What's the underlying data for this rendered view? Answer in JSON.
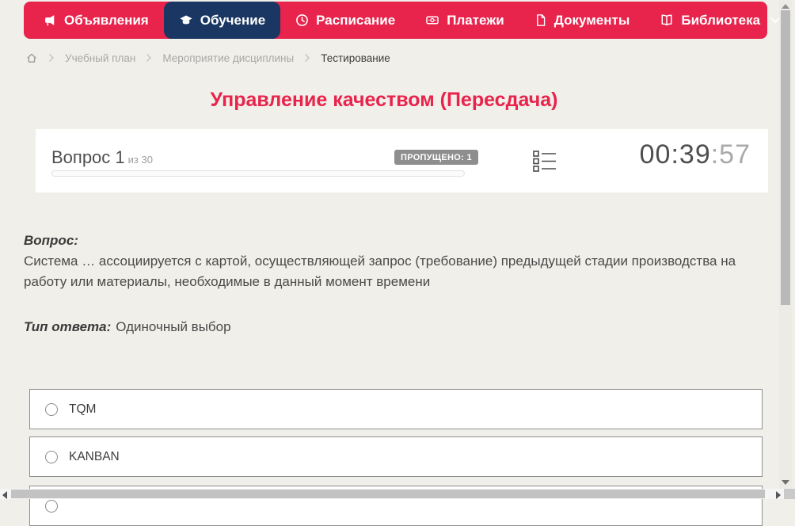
{
  "nav": {
    "items": [
      {
        "label": "Объявления",
        "icon": "megaphone-icon",
        "active": false
      },
      {
        "label": "Обучение",
        "icon": "graduation-cap-icon",
        "active": true
      },
      {
        "label": "Расписание",
        "icon": "clock-icon",
        "active": false
      },
      {
        "label": "Платежи",
        "icon": "banknote-icon",
        "active": false
      },
      {
        "label": "Документы",
        "icon": "document-icon",
        "active": false
      },
      {
        "label": "Библиотека",
        "icon": "book-icon",
        "active": false,
        "has_dropdown": true
      }
    ]
  },
  "breadcrumb": {
    "items": [
      "Учебный план",
      "Мероприятие дисциплины",
      "Тестирование"
    ]
  },
  "page": {
    "title": "Управление качеством (Пересдача)"
  },
  "quiz": {
    "question_label": "Вопрос 1",
    "question_of": "из 30",
    "skipped_badge": "ПРОПУЩЕНО: 1",
    "progress_percent": 0,
    "timer_main": "00:39",
    "timer_seconds": ":57",
    "question_heading": "Вопрос:",
    "question_text": "Система … ассоциируется с картой, осуществляющей запрос (требование) предыдущей стадии производства на работу или материалы, необходимые в данный момент времени",
    "answer_type_label": "Тип ответа:",
    "answer_type_value": "Одиночный выбор",
    "options": [
      {
        "label": "TQM",
        "selected": false
      },
      {
        "label": "KANBAN",
        "selected": false
      },
      {
        "label": "",
        "selected": false
      }
    ]
  },
  "colors": {
    "accent_red": "#e8234c",
    "active_navy": "#1a3763",
    "page_background": "#f1efe9",
    "badge_gray": "#8e8e8e"
  }
}
